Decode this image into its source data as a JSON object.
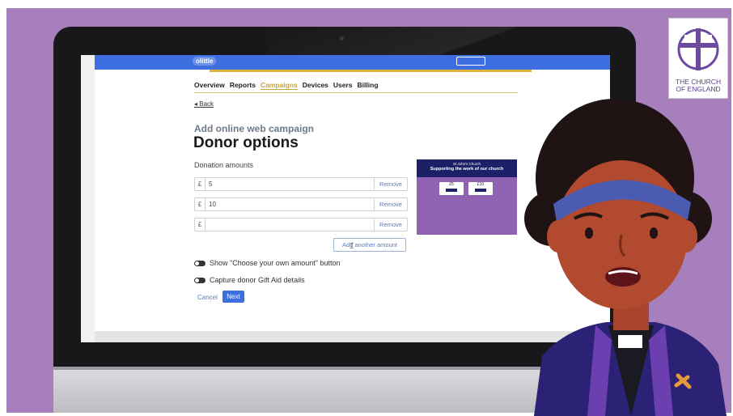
{
  "brand": {
    "logo_text": "olittle",
    "badge_line1": "THE CHURCH",
    "badge_line2": "OF ENGLAND"
  },
  "nav": {
    "tabs": [
      "Overview",
      "Reports",
      "Campaigns",
      "Devices",
      "Users",
      "Billing"
    ],
    "active": "Campaigns"
  },
  "back_label": "Back",
  "page": {
    "subtitle": "Add online web campaign",
    "title": "Donor options"
  },
  "donation": {
    "label": "Donation amounts",
    "currency": "£",
    "rows": [
      {
        "value": "5",
        "remove": "Remove"
      },
      {
        "value": "10",
        "remove": "Remove"
      },
      {
        "value": "",
        "remove": "Remove"
      }
    ],
    "add_label": "Add another amount"
  },
  "toggles": [
    {
      "label": "Show \"Choose your own amount\" button"
    },
    {
      "label": "Capture donor Gift Aid details"
    }
  ],
  "actions": {
    "cancel": "Cancel",
    "next": "Next"
  },
  "preview": {
    "church": "St John's Church",
    "title": "Supporting the work of our church",
    "amounts": [
      "£5",
      "£10"
    ]
  },
  "colors": {
    "purple_bg": "#a77fbd",
    "accent_blue": "#3e6fe0",
    "gold": "#c9a23a",
    "preview_purple": "#8f62b2",
    "preview_navy": "#1c2167"
  }
}
